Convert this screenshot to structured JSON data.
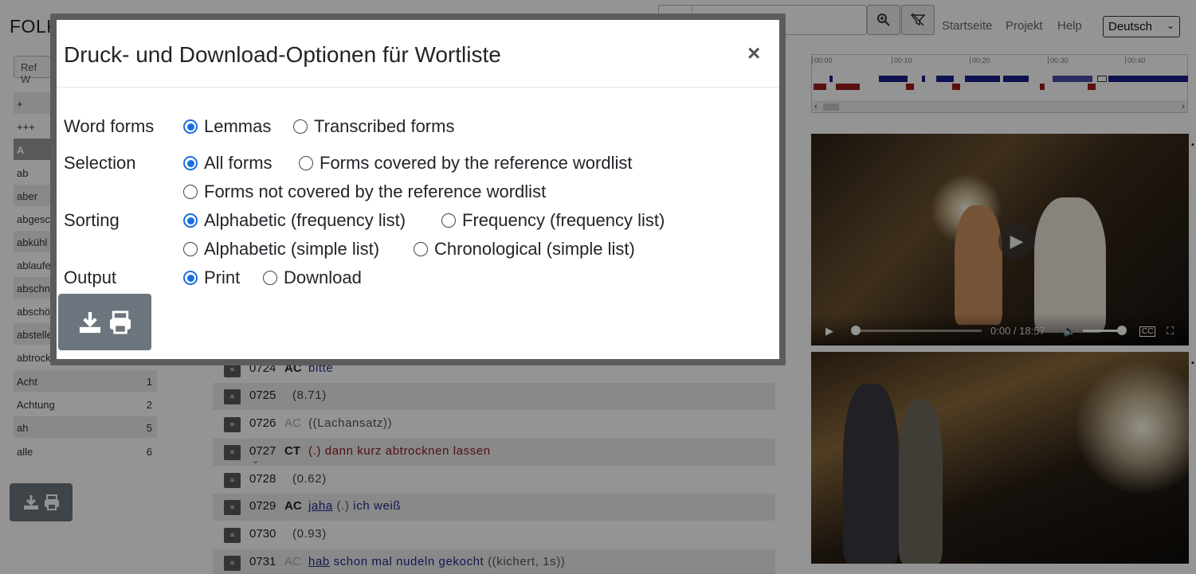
{
  "app": {
    "brand": "FOLK",
    "nav": [
      "Startseite",
      "Projekt",
      "Help"
    ],
    "language": "Deutsch",
    "ref_button": "Ref W"
  },
  "timeline": {
    "ticks": [
      "00:00",
      "00:10",
      "00:20",
      "00:30",
      "00:40"
    ]
  },
  "video1": {
    "time": "0:00 / 18:57"
  },
  "wordlist": {
    "rows": [
      {
        "word": "+",
        "count": ""
      },
      {
        "word": "+++",
        "count": ""
      },
      {
        "word": "A",
        "count": ""
      },
      {
        "word": "ab",
        "count": ""
      },
      {
        "word": "aber",
        "count": ""
      },
      {
        "word": "abgesc",
        "count": ""
      },
      {
        "word": "abkühl",
        "count": ""
      },
      {
        "word": "ablaufe",
        "count": ""
      },
      {
        "word": "abschn",
        "count": ""
      },
      {
        "word": "abschö",
        "count": ""
      },
      {
        "word": "abstelle",
        "count": ""
      },
      {
        "word": "abtrock",
        "count": ""
      },
      {
        "word": "Acht",
        "count": "1"
      },
      {
        "word": "Achtung",
        "count": "2"
      },
      {
        "word": "ah",
        "count": "5"
      },
      {
        "word": "alle",
        "count": "6"
      }
    ]
  },
  "transcript": {
    "rows": [
      {
        "num": "0724",
        "speaker": "AC",
        "pause": "",
        "parts": [
          "bitte"
        ]
      },
      {
        "num": "0725",
        "speaker": "",
        "pause": "(8.71)",
        "parts": []
      },
      {
        "num": "0726",
        "speaker": "AC",
        "pause": "",
        "parts": [
          "((Lachansatz))"
        ]
      },
      {
        "num": "0727",
        "speaker": "CT",
        "pause": "",
        "parts": [
          "(.)",
          "dann kurz abtrocknen lassen"
        ]
      },
      {
        "num": "0728",
        "speaker": "",
        "pause": "(0.62)",
        "parts": []
      },
      {
        "num": "0729",
        "speaker": "AC",
        "pause": "",
        "parts": [
          "jaha",
          "(.)",
          "ich weiß"
        ]
      },
      {
        "num": "0730",
        "speaker": "",
        "pause": "(0.93)",
        "parts": []
      },
      {
        "num": "0731",
        "speaker": "AC",
        "pause": "",
        "parts": [
          "hab",
          "schon mal nudeln gekocht",
          "((kichert, 1s))"
        ]
      }
    ]
  },
  "modal": {
    "title": "Druck- und Download-Optionen für Wortliste",
    "close": "×",
    "word_forms": {
      "label": "Word forms",
      "options": [
        "Lemmas",
        "Transcribed forms"
      ],
      "selected": "Lemmas"
    },
    "selection": {
      "label": "Selection",
      "options": [
        "All forms",
        "Forms covered by the reference wordlist",
        "Forms not covered by the reference wordlist"
      ],
      "selected": "All forms"
    },
    "sorting": {
      "label": "Sorting",
      "options": [
        "Alphabetic (frequency list)",
        "Frequency (frequency list)",
        "Alphabetic (simple list)",
        "Chronological (simple list)"
      ],
      "selected": "Alphabetic (frequency list)"
    },
    "output": {
      "label": "Output",
      "options": [
        "Print",
        "Download"
      ],
      "selected": "Print"
    },
    "action_icons": [
      "download-icon",
      "print-icon"
    ]
  },
  "colors": {
    "accent": "#1a6fe0",
    "button_gray": "#6c757d",
    "timeline_blue": "#1b1f8a",
    "timeline_red": "#9b1c1c"
  }
}
